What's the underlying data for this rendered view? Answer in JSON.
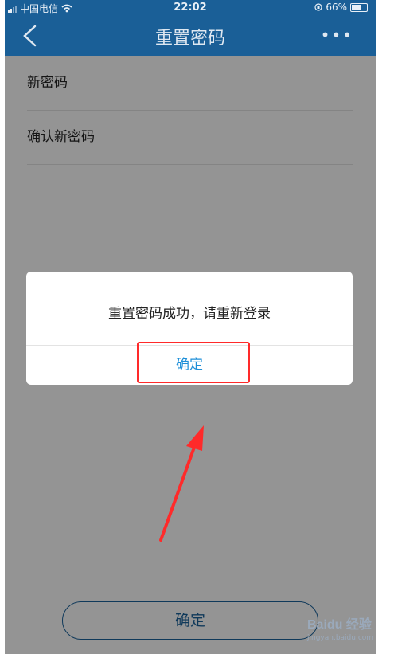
{
  "status": {
    "carrier": "中国电信",
    "time": "22:02",
    "battery": "66%"
  },
  "nav": {
    "title": "重置密码",
    "more_label": "•••"
  },
  "form": {
    "new_password_label": "新密码",
    "confirm_password_label": "确认新密码",
    "submit_label": "确定"
  },
  "dialog": {
    "message": "重置密码成功，请重新登录",
    "ok_label": "确定"
  },
  "watermark": {
    "brand": "Baidu 经验",
    "url": "jingyan.baidu.com"
  },
  "colors": {
    "primary": "#1a5f97",
    "dialog_button": "#1e8fd8",
    "annotation": "#ff2a2a"
  }
}
